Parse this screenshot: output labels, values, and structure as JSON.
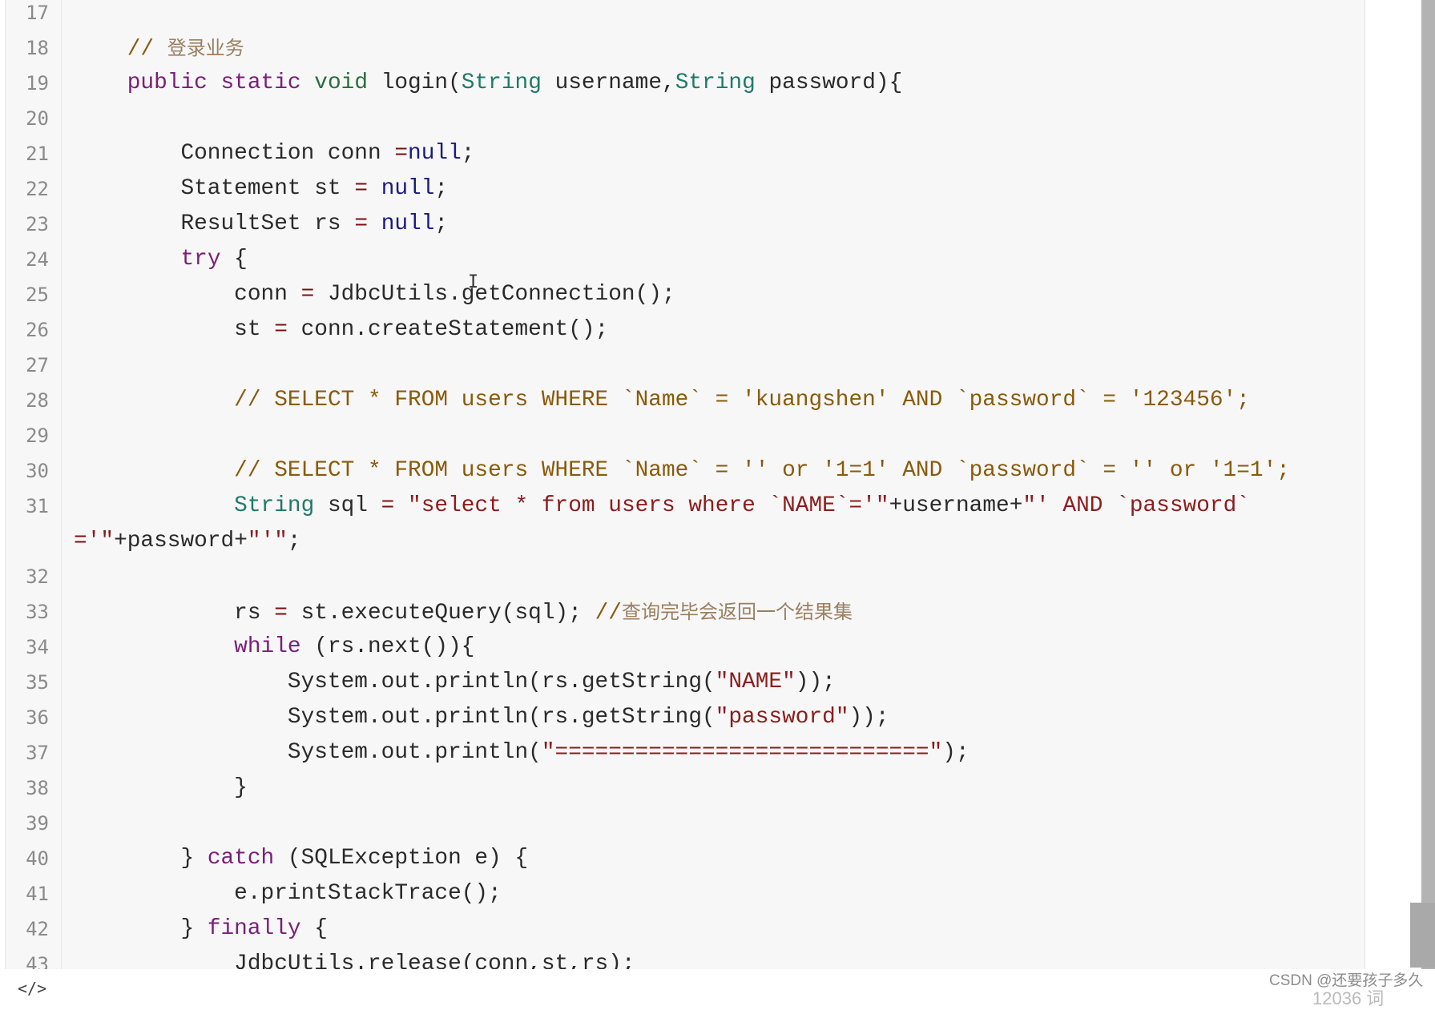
{
  "editor": {
    "lines": [
      {
        "n": "17",
        "t": []
      },
      {
        "n": "18",
        "t": [
          [
            "    ",
            ""
          ],
          [
            "// ",
            "cm"
          ],
          [
            "登录业务",
            "cmc"
          ]
        ]
      },
      {
        "n": "19",
        "t": [
          [
            "    ",
            ""
          ],
          [
            "public static ",
            "kw"
          ],
          [
            "void",
            "vd"
          ],
          [
            " login(",
            ""
          ],
          [
            "String",
            "ty"
          ],
          [
            " username,",
            ""
          ],
          [
            "String",
            "ty"
          ],
          [
            " password){",
            ""
          ]
        ]
      },
      {
        "n": "20",
        "t": []
      },
      {
        "n": "21",
        "t": [
          [
            "        Connection conn ",
            ""
          ],
          [
            "=",
            "op"
          ],
          [
            "null",
            "nl"
          ],
          [
            ";",
            ""
          ]
        ]
      },
      {
        "n": "22",
        "t": [
          [
            "        Statement st ",
            ""
          ],
          [
            "=",
            "op"
          ],
          [
            " ",
            ""
          ],
          [
            "null",
            "nl"
          ],
          [
            ";",
            ""
          ]
        ]
      },
      {
        "n": "23",
        "t": [
          [
            "        ResultSet rs ",
            ""
          ],
          [
            "=",
            "op"
          ],
          [
            " ",
            ""
          ],
          [
            "null",
            "nl"
          ],
          [
            ";",
            ""
          ]
        ]
      },
      {
        "n": "24",
        "t": [
          [
            "        ",
            ""
          ],
          [
            "try",
            "kw"
          ],
          [
            " {",
            ""
          ]
        ]
      },
      {
        "n": "25",
        "t": [
          [
            "            conn ",
            ""
          ],
          [
            "=",
            "op"
          ],
          [
            " JdbcUtils.getConnection();",
            ""
          ]
        ]
      },
      {
        "n": "26",
        "t": [
          [
            "            st ",
            ""
          ],
          [
            "=",
            "op"
          ],
          [
            " conn.createStatement();",
            ""
          ]
        ]
      },
      {
        "n": "27",
        "t": []
      },
      {
        "n": "28",
        "t": [
          [
            "            ",
            ""
          ],
          [
            "// SELECT * FROM users WHERE `Name` = 'kuangshen' AND `password` = '123456';",
            "cm"
          ]
        ]
      },
      {
        "n": "29",
        "t": []
      },
      {
        "n": "30",
        "t": [
          [
            "            ",
            ""
          ],
          [
            "// SELECT * FROM users WHERE `Name` = '' or '1=1' AND `password` = '' or '1=1';",
            "cm"
          ]
        ]
      },
      {
        "n": "31",
        "t": [
          [
            "            ",
            ""
          ],
          [
            "String",
            "ty"
          ],
          [
            " sql ",
            ""
          ],
          [
            "=",
            "op"
          ],
          [
            " ",
            ""
          ],
          [
            "\"select * from users where `NAME`='\"",
            "st"
          ],
          [
            "+username+",
            ""
          ],
          [
            "\"' AND `password`",
            "st"
          ]
        ]
      },
      {
        "n": "",
        "t": [
          [
            "=",
            "op"
          ],
          [
            "'\"",
            "st"
          ],
          [
            "+password+",
            ""
          ],
          [
            "\"'\"",
            "st"
          ],
          [
            ";",
            ""
          ]
        ]
      },
      {
        "n": "32",
        "t": []
      },
      {
        "n": "33",
        "t": [
          [
            "            rs ",
            ""
          ],
          [
            "=",
            "op"
          ],
          [
            " st.executeQuery(sql); ",
            ""
          ],
          [
            "//",
            "cm"
          ],
          [
            "查询完毕会返回一个结果集",
            "cmc"
          ]
        ]
      },
      {
        "n": "34",
        "t": [
          [
            "            ",
            ""
          ],
          [
            "while",
            "kw"
          ],
          [
            " (rs.next()){",
            ""
          ]
        ]
      },
      {
        "n": "35",
        "t": [
          [
            "                System.out.println(rs.getString(",
            ""
          ],
          [
            "\"NAME\"",
            "st"
          ],
          [
            "));",
            ""
          ]
        ]
      },
      {
        "n": "36",
        "t": [
          [
            "                System.out.println(rs.getString(",
            ""
          ],
          [
            "\"password\"",
            "st"
          ],
          [
            "));",
            ""
          ]
        ]
      },
      {
        "n": "37",
        "t": [
          [
            "                System.out.println(",
            ""
          ],
          [
            "\"============================\"",
            "st"
          ],
          [
            ");",
            ""
          ]
        ]
      },
      {
        "n": "38",
        "t": [
          [
            "            }",
            ""
          ]
        ]
      },
      {
        "n": "39",
        "t": []
      },
      {
        "n": "40",
        "t": [
          [
            "        } ",
            ""
          ],
          [
            "catch",
            "kw"
          ],
          [
            " (SQLException e) {",
            ""
          ]
        ]
      },
      {
        "n": "41",
        "t": [
          [
            "            e.printStackTrace();",
            ""
          ]
        ]
      },
      {
        "n": "42",
        "t": [
          [
            "        } ",
            ""
          ],
          [
            "finally",
            "kw"
          ],
          [
            " {",
            ""
          ]
        ]
      },
      {
        "n": "43",
        "t": [
          [
            "            JdbcUtils.release(conn,st,rs);",
            ""
          ]
        ]
      }
    ]
  },
  "cursor_glyph": "I",
  "footer": {
    "icon": "</>",
    "icon_name": "code-icon",
    "watermark": "CSDN @还要孩子多久",
    "word_count": "12036 词"
  }
}
